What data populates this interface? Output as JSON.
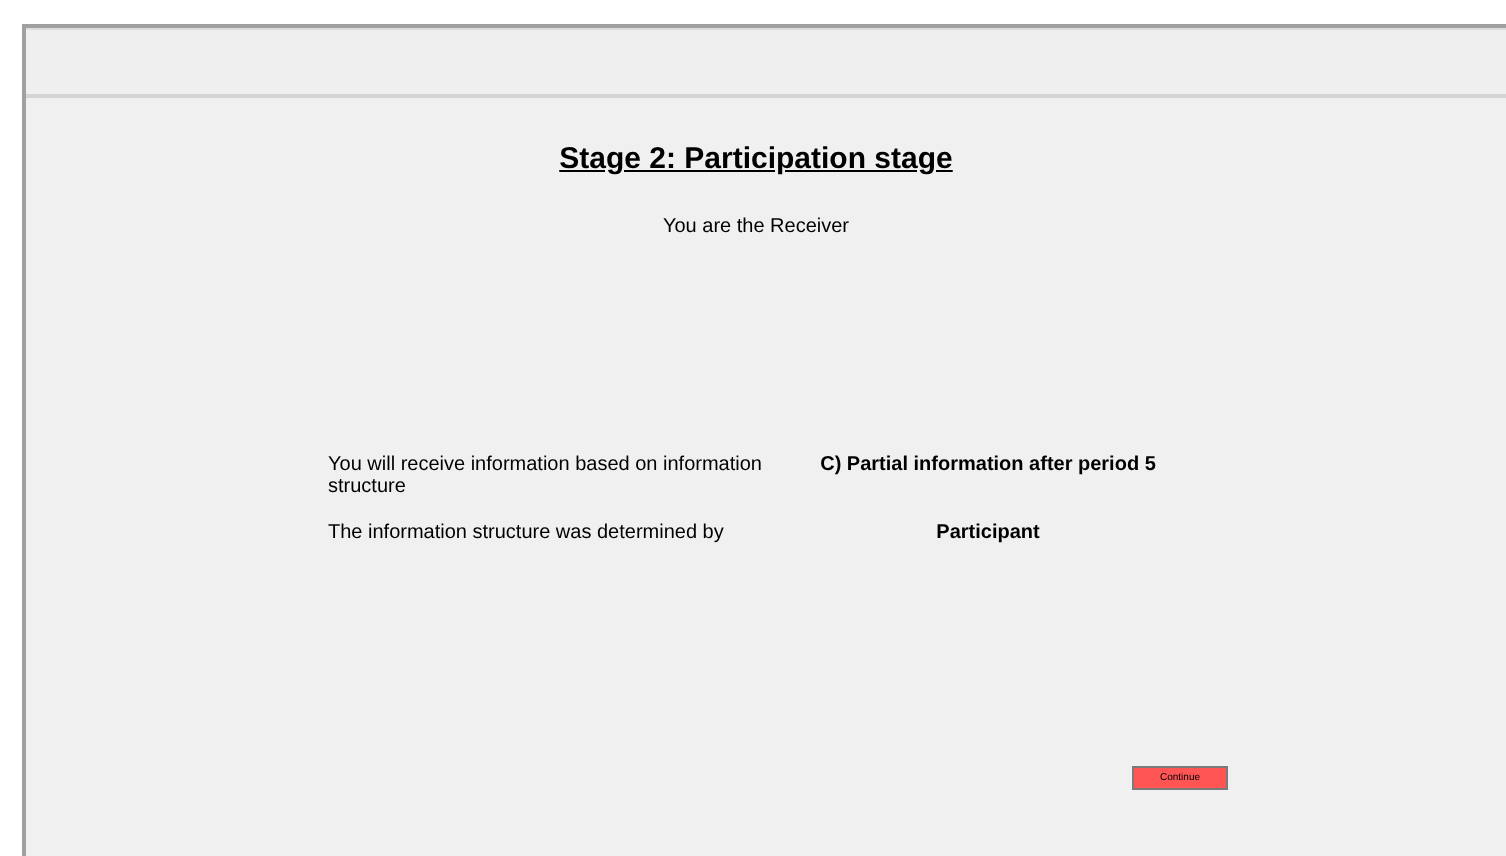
{
  "title": "Stage 2: Participation stage",
  "subtitle": "You are the Receiver",
  "rows": [
    {
      "label": "You will receive information based on information structure",
      "value": "C) Partial information after period 5"
    },
    {
      "label": "The information structure was determined by",
      "value": "Participant"
    }
  ],
  "buttons": [
    {
      "label": "Continue"
    }
  ]
}
